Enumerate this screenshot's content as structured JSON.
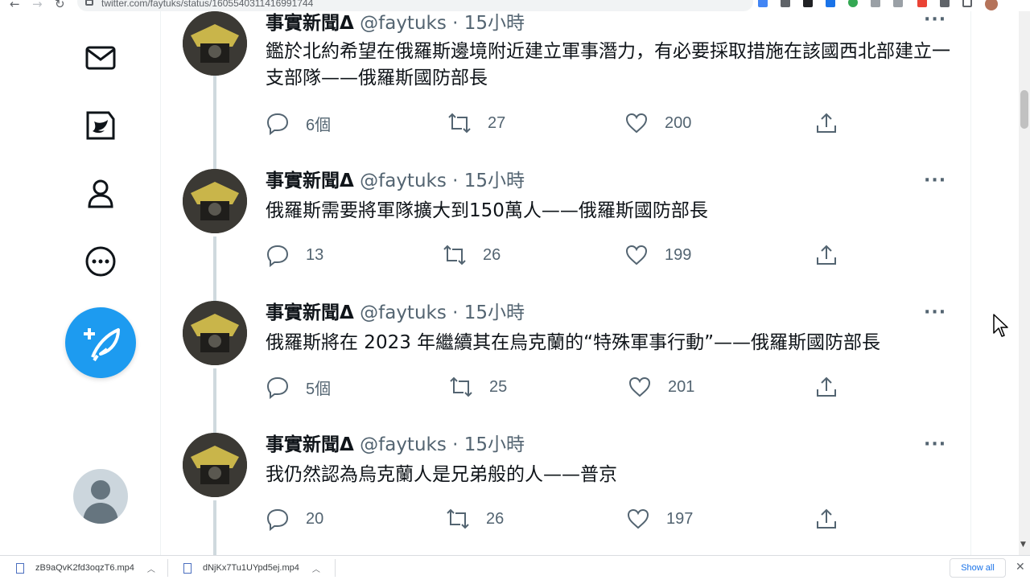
{
  "browser": {
    "url": "twitter.com/faytuks/status/1605540311416991744",
    "ext_colors": [
      "#4285f4",
      "#5f6368",
      "#000000",
      "#1a73e8",
      "#34a853",
      "#5f6368",
      "#5f6368",
      "#ea4335",
      "#5f6368",
      "#5f6368"
    ]
  },
  "tweets": [
    {
      "name": "事實新聞Δ",
      "handle": "@faytuks",
      "dot": "·",
      "time": "15小時",
      "more": "···",
      "text": "鑑於北約希望在俄羅斯邊境附近建立軍事潛力，有必要採取措施在該國西北部建立一支部隊——俄羅斯國防部長",
      "replies": "6個",
      "retweets": "27",
      "likes": "200"
    },
    {
      "name": "事實新聞Δ",
      "handle": "@faytuks",
      "dot": "·",
      "time": "15小時",
      "more": "···",
      "text": "俄羅斯需要將軍隊擴大到150萬人——俄羅斯國防部長",
      "replies": "13",
      "retweets": "26",
      "likes": "199"
    },
    {
      "name": "事實新聞Δ",
      "handle": "@faytuks",
      "dot": "·",
      "time": "15小時",
      "more": "···",
      "text": "俄羅斯將在 2023 年繼續其在烏克蘭的“特殊軍事行動”——俄羅斯國防部長",
      "replies": "5個",
      "retweets": "25",
      "likes": "201"
    },
    {
      "name": "事實新聞Δ",
      "handle": "@faytuks",
      "dot": "·",
      "time": "15小時",
      "more": "···",
      "text": "我仍然認為烏克蘭人是兄弟般的人——普京",
      "replies": "20",
      "retweets": "26",
      "likes": "197"
    }
  ],
  "downloads": {
    "items": [
      "zB9aQvK2fd3oqzT6.mp4",
      "dNjKx7Tu1UYpd5ej.mp4"
    ],
    "show_all": "Show all"
  },
  "colors": {
    "accent": "#1d9bf0",
    "text_primary": "#0f1419",
    "text_secondary": "#536471",
    "thread_line": "#cfd9de"
  }
}
